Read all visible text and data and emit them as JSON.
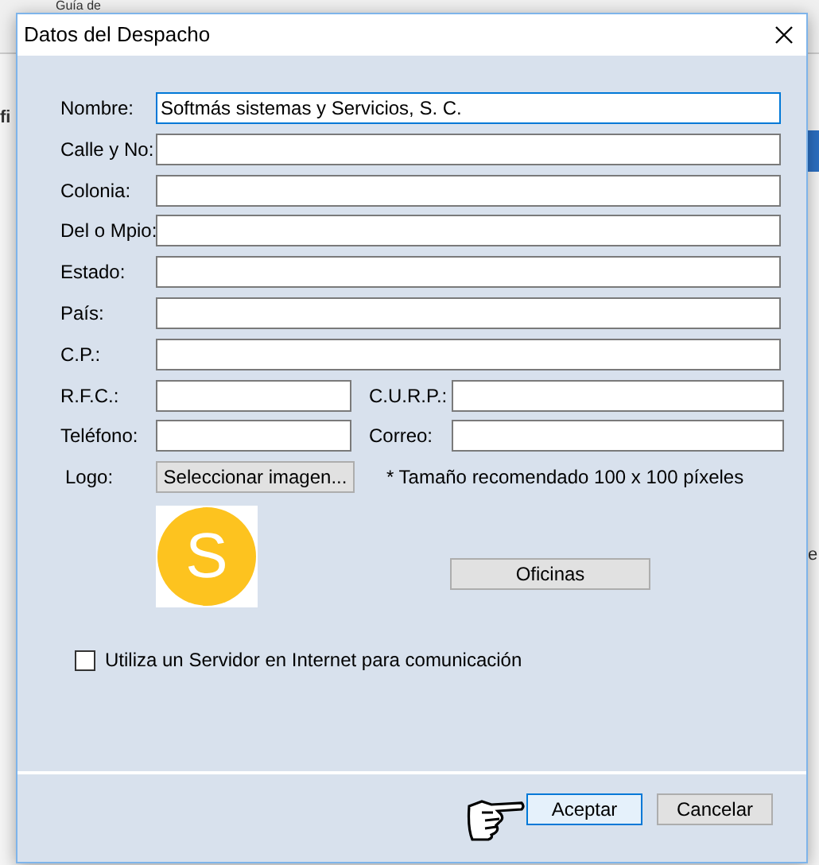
{
  "background": {
    "toolbar_text": "Guía de",
    "left_text": "fi",
    "right_text": "e"
  },
  "window": {
    "title": "Datos del Despacho"
  },
  "rows": [
    {
      "fields": [
        {
          "label": "Nombre:",
          "value": "Softmás sistemas y Servicios, S. C.",
          "focused": true
        }
      ]
    },
    {
      "fields": [
        {
          "label": "Calle y No:",
          "focused": false
        }
      ]
    },
    {
      "fields": [
        {
          "label": "Colonia:",
          "focused": false
        }
      ]
    },
    {
      "fields": [
        {
          "label": "Del o Mpio:",
          "focused": false
        }
      ]
    },
    {
      "fields": [
        {
          "label": "Estado:",
          "focused": false
        }
      ]
    },
    {
      "fields": [
        {
          "label": "País:",
          "focused": false
        }
      ]
    },
    {
      "fields": [
        {
          "label": "C.P.:",
          "focused": false
        }
      ]
    },
    {
      "fields": [
        {
          "label": "R.F.C.:",
          "focused": false
        },
        {
          "label": "C.U.R.P.:",
          "focused": false
        }
      ]
    },
    {
      "fields": [
        {
          "label": "Teléfono:",
          "focused": false
        },
        {
          "label": "Correo:",
          "focused": false
        }
      ]
    }
  ],
  "logo": {
    "label": "Logo:",
    "button": "Seleccionar imagen...",
    "note": "* Tamaño recomendado 100 x 100 píxeles",
    "letter": "S",
    "color": "#fdc31f"
  },
  "offices_button": "Oficinas",
  "server_checkbox": {
    "label": "Utiliza un Servidor en Internet para comunicación",
    "checked": false
  },
  "buttons": [
    {
      "label": "Aceptar",
      "default": true
    },
    {
      "label": "Cancelar",
      "default": false
    }
  ]
}
